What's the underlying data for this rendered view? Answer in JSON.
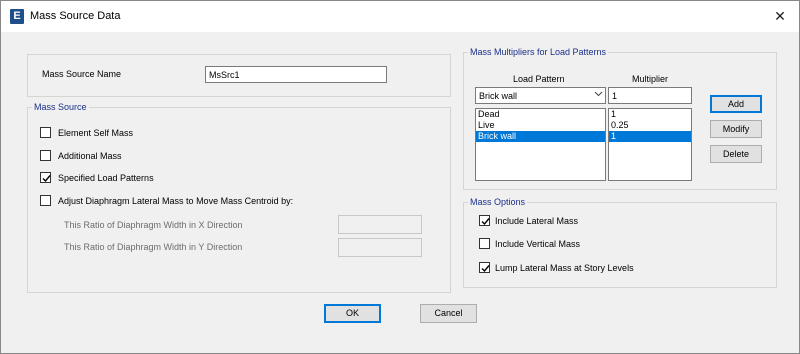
{
  "window": {
    "title": "Mass Source Data",
    "icon_letter": "E",
    "close_glyph": "✕"
  },
  "name_section": {
    "label": "Mass Source Name",
    "value": "MsSrc1"
  },
  "mass_source": {
    "legend": "Mass Source",
    "element_self_mass": {
      "label": "Element Self Mass",
      "checked": false
    },
    "additional_mass": {
      "label": "Additional Mass",
      "checked": false
    },
    "specified_load_patterns": {
      "label": "Specified Load Patterns",
      "checked": true
    },
    "adjust_diaphragm": {
      "label": "Adjust Diaphragm Lateral Mass to Move Mass Centroid by:",
      "checked": false
    },
    "ratio_x_label": "This Ratio of Diaphragm Width in X Direction",
    "ratio_y_label": "This Ratio of Diaphragm Width in Y Direction",
    "ratio_x_value": "",
    "ratio_y_value": ""
  },
  "multipliers": {
    "legend": "Mass Multipliers for Load Patterns",
    "col_load_pattern": "Load Pattern",
    "col_multiplier": "Multiplier",
    "load_pattern_selected": "Brick wall",
    "multiplier_value": "1",
    "rows": [
      {
        "pattern": "Dead",
        "multiplier": "1"
      },
      {
        "pattern": "Live",
        "multiplier": "0.25"
      },
      {
        "pattern": "Brick wall",
        "multiplier": "1"
      }
    ],
    "selected_index": 2,
    "add_label": "Add",
    "modify_label": "Modify",
    "delete_label": "Delete"
  },
  "mass_options": {
    "legend": "Mass Options",
    "include_lateral": {
      "label": "Include Lateral Mass",
      "checked": true
    },
    "include_vertical": {
      "label": "Include Vertical Mass",
      "checked": false
    },
    "lump_lateral": {
      "label": "Lump Lateral Mass at Story Levels",
      "checked": true
    }
  },
  "buttons": {
    "ok_label": "OK",
    "cancel_label": "Cancel"
  },
  "colors": {
    "accent": "#0078d7",
    "legend_text": "#1a2f8a",
    "selection": "#0078d7"
  }
}
